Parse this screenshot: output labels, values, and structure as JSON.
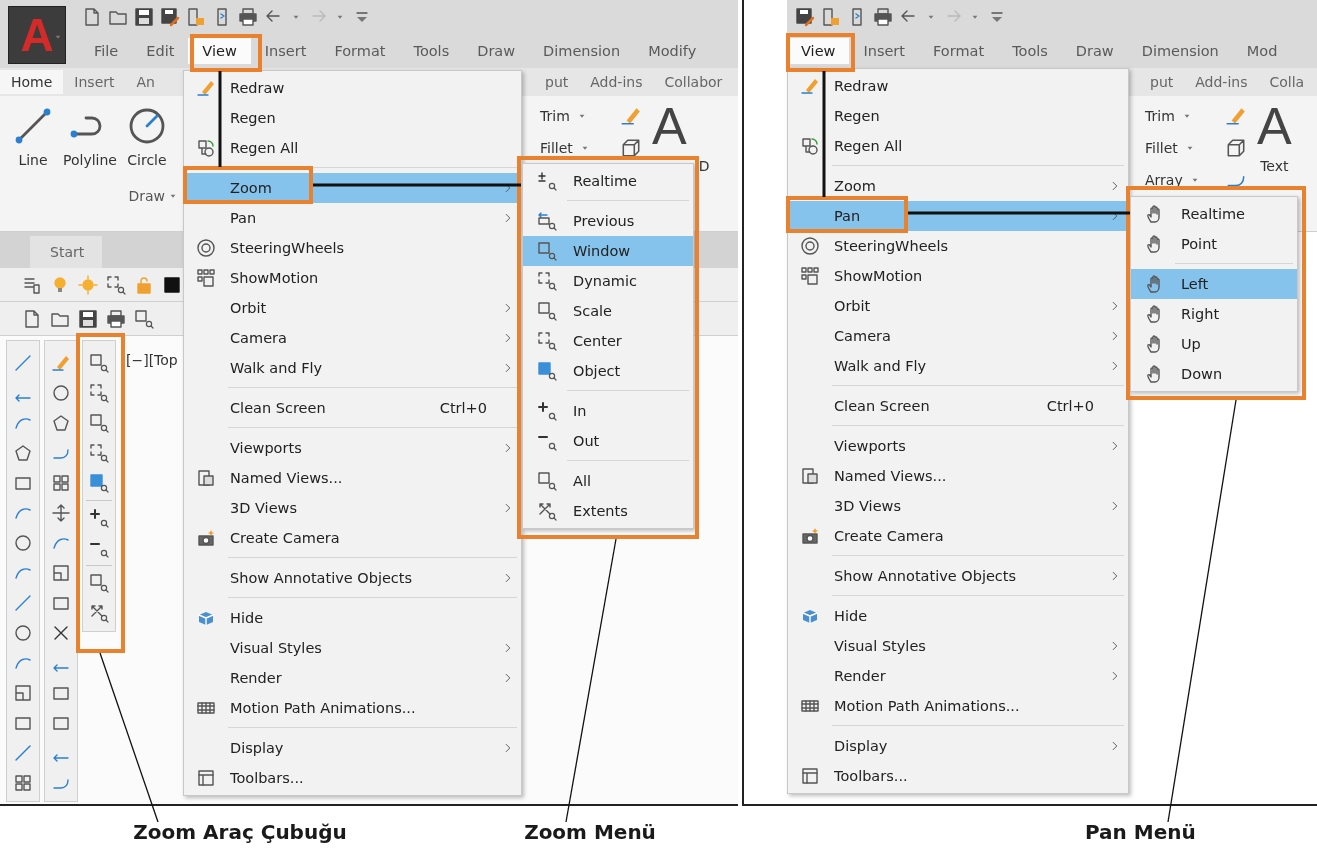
{
  "zoom_panel": {
    "logo": "A",
    "menu_bar": [
      {
        "label": "File",
        "selected": false
      },
      {
        "label": "Edit",
        "selected": false
      },
      {
        "label": "View",
        "selected": true
      },
      {
        "label": "Insert",
        "selected": false
      },
      {
        "label": "Format",
        "selected": false
      },
      {
        "label": "Tools",
        "selected": false
      },
      {
        "label": "Draw",
        "selected": false
      },
      {
        "label": "Dimension",
        "selected": false
      },
      {
        "label": "Modify",
        "selected": false
      }
    ],
    "ribbon_tabs_left": [
      {
        "label": "Home",
        "selected": true
      },
      {
        "label": "Insert",
        "selected": false
      },
      {
        "label": "An",
        "selected": false
      }
    ],
    "ribbon_tabs_right": [
      {
        "label": "put",
        "selected": false
      },
      {
        "label": "Add-ins",
        "selected": false
      },
      {
        "label": "Collabor",
        "selected": false
      }
    ],
    "draw_tools": [
      "Line",
      "Polyline",
      "Circle"
    ],
    "draw_panel_label": "Draw",
    "modify_tools": [
      "Trim",
      "Fillet"
    ],
    "text_tool_glyph": "A",
    "cut_tool_label": "D",
    "file_tab": "Start",
    "viewport_label": "[−][Top",
    "view_menu": [
      {
        "label": "Redraw",
        "separator_before": false,
        "submenu": false,
        "selected": false
      },
      {
        "label": "Regen",
        "separator_before": false,
        "submenu": false,
        "selected": false
      },
      {
        "label": "Regen All",
        "separator_before": false,
        "submenu": false,
        "selected": false
      },
      {
        "label": "Zoom",
        "separator_before": true,
        "submenu": true,
        "selected": true
      },
      {
        "label": "Pan",
        "separator_before": false,
        "submenu": true,
        "selected": false
      },
      {
        "label": "SteeringWheels",
        "separator_before": false,
        "submenu": false,
        "selected": false
      },
      {
        "label": "ShowMotion",
        "separator_before": false,
        "submenu": false,
        "selected": false
      },
      {
        "label": "Orbit",
        "separator_before": false,
        "submenu": true,
        "selected": false
      },
      {
        "label": "Camera",
        "separator_before": false,
        "submenu": true,
        "selected": false
      },
      {
        "label": "Walk and Fly",
        "separator_before": false,
        "submenu": true,
        "selected": false
      },
      {
        "label": "Clean Screen",
        "shortcut": "Ctrl+0",
        "separator_before": true,
        "submenu": false,
        "selected": false
      },
      {
        "label": "Viewports",
        "separator_before": true,
        "submenu": true,
        "selected": false
      },
      {
        "label": "Named Views...",
        "separator_before": false,
        "submenu": false,
        "selected": false
      },
      {
        "label": "3D Views",
        "separator_before": false,
        "submenu": true,
        "selected": false
      },
      {
        "label": "Create Camera",
        "separator_before": false,
        "submenu": false,
        "selected": false
      },
      {
        "label": "Show Annotative Objects",
        "separator_before": true,
        "submenu": true,
        "selected": false
      },
      {
        "label": "Hide",
        "separator_before": true,
        "submenu": false,
        "selected": false
      },
      {
        "label": "Visual Styles",
        "separator_before": false,
        "submenu": true,
        "selected": false
      },
      {
        "label": "Render",
        "separator_before": false,
        "submenu": true,
        "selected": false
      },
      {
        "label": "Motion Path Animations...",
        "separator_before": false,
        "submenu": false,
        "selected": false
      },
      {
        "label": "Display",
        "separator_before": true,
        "submenu": true,
        "selected": false
      },
      {
        "label": "Toolbars...",
        "separator_before": false,
        "submenu": false,
        "selected": false
      }
    ],
    "submenu": {
      "kind": "zoom",
      "items": [
        {
          "label": "Realtime",
          "separator_before": false,
          "selected": false
        },
        {
          "label": "Previous",
          "separator_before": true,
          "selected": false
        },
        {
          "label": "Window",
          "separator_before": false,
          "selected": true
        },
        {
          "label": "Dynamic",
          "separator_before": false,
          "selected": false
        },
        {
          "label": "Scale",
          "separator_before": false,
          "selected": false
        },
        {
          "label": "Center",
          "separator_before": false,
          "selected": false
        },
        {
          "label": "Object",
          "separator_before": false,
          "selected": false
        },
        {
          "label": "In",
          "separator_before": true,
          "selected": false
        },
        {
          "label": "Out",
          "separator_before": false,
          "selected": false
        },
        {
          "label": "All",
          "separator_before": true,
          "selected": false
        },
        {
          "label": "Extents",
          "separator_before": false,
          "selected": false
        }
      ]
    }
  },
  "pan_panel": {
    "menu_bar": [
      {
        "label": "View",
        "selected": true
      },
      {
        "label": "Insert",
        "selected": false
      },
      {
        "label": "Format",
        "selected": false
      },
      {
        "label": "Tools",
        "selected": false
      },
      {
        "label": "Draw",
        "selected": false
      },
      {
        "label": "Dimension",
        "selected": false
      },
      {
        "label": "Mod",
        "selected": false
      }
    ],
    "ribbon_tabs_right": [
      {
        "label": "put",
        "selected": false
      },
      {
        "label": "Add-ins",
        "selected": false
      },
      {
        "label": "Colla",
        "selected": false
      }
    ],
    "modify_tools": [
      "Trim",
      "Fillet",
      "Array"
    ],
    "text_tool_glyph": "A",
    "text_tool_label": "Text",
    "view_menu": [
      {
        "label": "Redraw",
        "separator_before": false,
        "submenu": false,
        "selected": false
      },
      {
        "label": "Regen",
        "separator_before": false,
        "submenu": false,
        "selected": false
      },
      {
        "label": "Regen All",
        "separator_before": false,
        "submenu": false,
        "selected": false
      },
      {
        "label": "Zoom",
        "separator_before": true,
        "submenu": true,
        "selected": false
      },
      {
        "label": "Pan",
        "separator_before": false,
        "submenu": true,
        "selected": true
      },
      {
        "label": "SteeringWheels",
        "separator_before": false,
        "submenu": false,
        "selected": false
      },
      {
        "label": "ShowMotion",
        "separator_before": false,
        "submenu": false,
        "selected": false
      },
      {
        "label": "Orbit",
        "separator_before": false,
        "submenu": true,
        "selected": false
      },
      {
        "label": "Camera",
        "separator_before": false,
        "submenu": true,
        "selected": false
      },
      {
        "label": "Walk and Fly",
        "separator_before": false,
        "submenu": true,
        "selected": false
      },
      {
        "label": "Clean Screen",
        "shortcut": "Ctrl+0",
        "separator_before": true,
        "submenu": false,
        "selected": false
      },
      {
        "label": "Viewports",
        "separator_before": true,
        "submenu": true,
        "selected": false
      },
      {
        "label": "Named Views...",
        "separator_before": false,
        "submenu": false,
        "selected": false
      },
      {
        "label": "3D Views",
        "separator_before": false,
        "submenu": true,
        "selected": false
      },
      {
        "label": "Create Camera",
        "separator_before": false,
        "submenu": false,
        "selected": false
      },
      {
        "label": "Show Annotative Objects",
        "separator_before": true,
        "submenu": true,
        "selected": false
      },
      {
        "label": "Hide",
        "separator_before": true,
        "submenu": false,
        "selected": false
      },
      {
        "label": "Visual Styles",
        "separator_before": false,
        "submenu": true,
        "selected": false
      },
      {
        "label": "Render",
        "separator_before": false,
        "submenu": true,
        "selected": false
      },
      {
        "label": "Motion Path Animations...",
        "separator_before": false,
        "submenu": false,
        "selected": false
      },
      {
        "label": "Display",
        "separator_before": true,
        "submenu": true,
        "selected": false
      },
      {
        "label": "Toolbars...",
        "separator_before": false,
        "submenu": false,
        "selected": false
      }
    ],
    "submenu": {
      "kind": "pan",
      "items": [
        {
          "label": "Realtime",
          "separator_before": false,
          "selected": false
        },
        {
          "label": "Point",
          "separator_before": false,
          "selected": false
        },
        {
          "label": "Left",
          "separator_before": true,
          "selected": true
        },
        {
          "label": "Right",
          "separator_before": false,
          "selected": false
        },
        {
          "label": "Up",
          "separator_before": false,
          "selected": false
        },
        {
          "label": "Down",
          "separator_before": false,
          "selected": false
        }
      ]
    }
  },
  "captions": [
    "Zoom Araç Çubuğu",
    "Zoom Menü",
    "Pan Menü"
  ]
}
